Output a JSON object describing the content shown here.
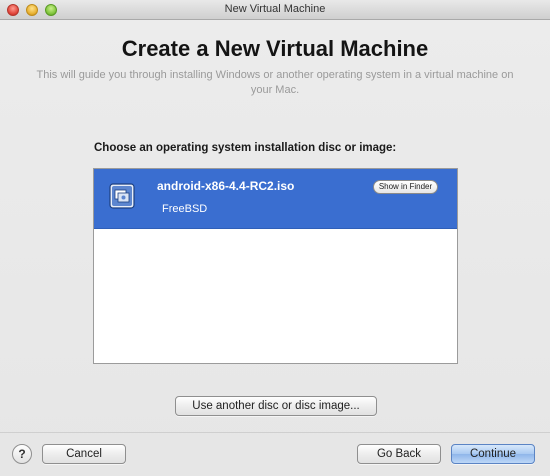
{
  "window": {
    "title": "New Virtual Machine"
  },
  "header": {
    "title": "Create a New Virtual Machine",
    "subtitle": "This will guide you through installing Windows or another operating system in a virtual machine on your Mac."
  },
  "choose_label": "Choose an operating system installation disc or image:",
  "disc_list": {
    "items": [
      {
        "name": "android-x86-4.4-RC2.iso",
        "os": "FreeBSD",
        "show_in_finder_label": "Show in Finder",
        "icon": "disc-image-icon",
        "selected": true
      }
    ]
  },
  "buttons": {
    "use_another": "Use another disc or disc image...",
    "help": "?",
    "cancel": "Cancel",
    "go_back": "Go Back",
    "continue": "Continue"
  },
  "colors": {
    "selection": "#3a6ed0",
    "default_button": "#a9c9f2"
  }
}
